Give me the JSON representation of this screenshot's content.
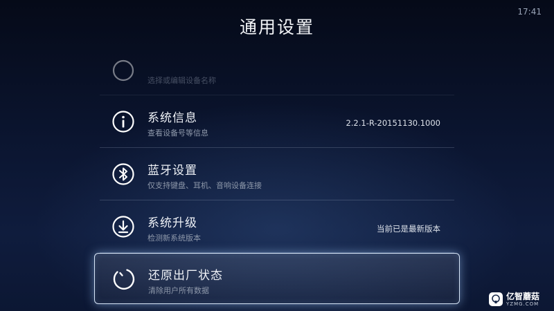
{
  "status": {
    "time": "17:41"
  },
  "header": {
    "title": "通用设置"
  },
  "items": [
    {
      "icon": "device-name-icon",
      "label": "",
      "sub": "选择或编辑设备名称",
      "value": ""
    },
    {
      "icon": "info-icon",
      "label": "系统信息",
      "sub": "查看设备号等信息",
      "value": "2.2.1-R-20151130.1000"
    },
    {
      "icon": "bluetooth-icon",
      "label": "蓝牙设置",
      "sub": "仅支持键盘、耳机、音响设备连接",
      "value": ""
    },
    {
      "icon": "download-icon",
      "label": "系统升级",
      "sub": "检测新系统版本",
      "value": "当前已是最新版本"
    },
    {
      "icon": "reset-icon",
      "label": "还原出厂状态",
      "sub": "清除用户所有数据",
      "value": ""
    }
  ],
  "watermark": {
    "name": "亿智蘑菇",
    "url": "YZMG.COM"
  },
  "colors": {
    "accent": "#d8e6f8",
    "background": "#0b1530"
  }
}
